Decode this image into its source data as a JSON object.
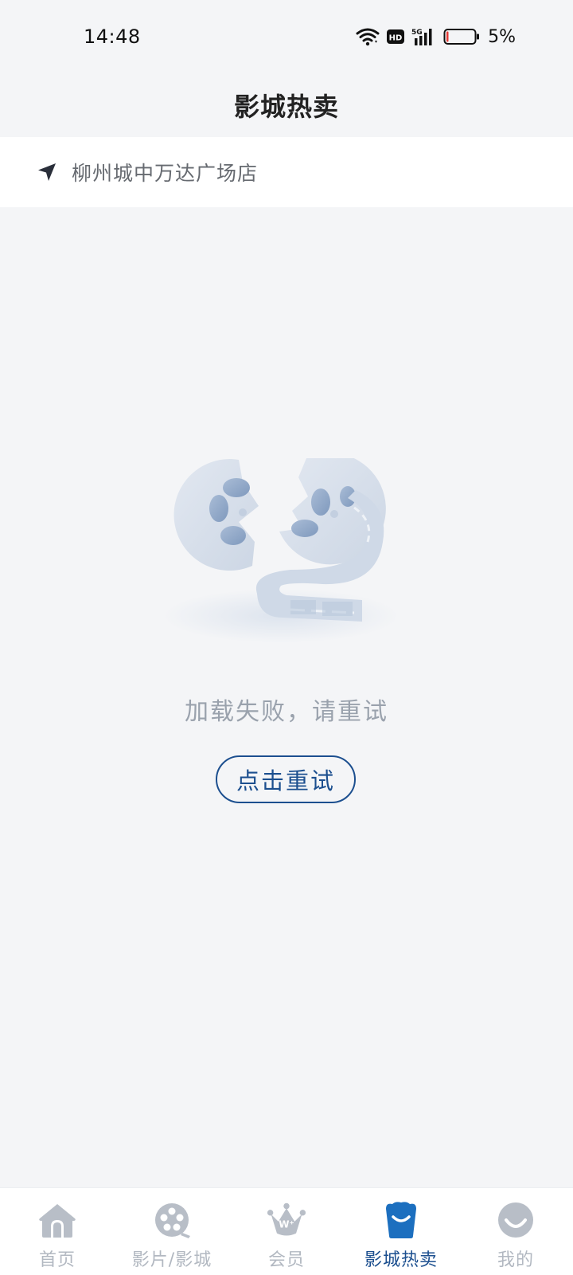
{
  "status_bar": {
    "time": "14:48",
    "network": "5G",
    "hd": "HD",
    "battery": "5%"
  },
  "header": {
    "title": "影城热卖"
  },
  "location": {
    "icon": "location-arrow-icon",
    "cinema_name": "柳州城中万达广场店"
  },
  "empty_state": {
    "illustration": "film-reel-icon",
    "message": "加载失败，请重试",
    "retry_label": "点击重试"
  },
  "bottom_nav": {
    "active_index": 3,
    "active_color": "#1c4f8f",
    "inactive_color": "#b2b8c1",
    "items": [
      {
        "label": "首页",
        "icon": "home-icon"
      },
      {
        "label": "影片/影城",
        "icon": "film-reel-icon"
      },
      {
        "label": "会员",
        "icon": "crown-icon"
      },
      {
        "label": "影城热卖",
        "icon": "popcorn-bucket-icon"
      },
      {
        "label": "我的",
        "icon": "smiley-icon"
      }
    ]
  }
}
